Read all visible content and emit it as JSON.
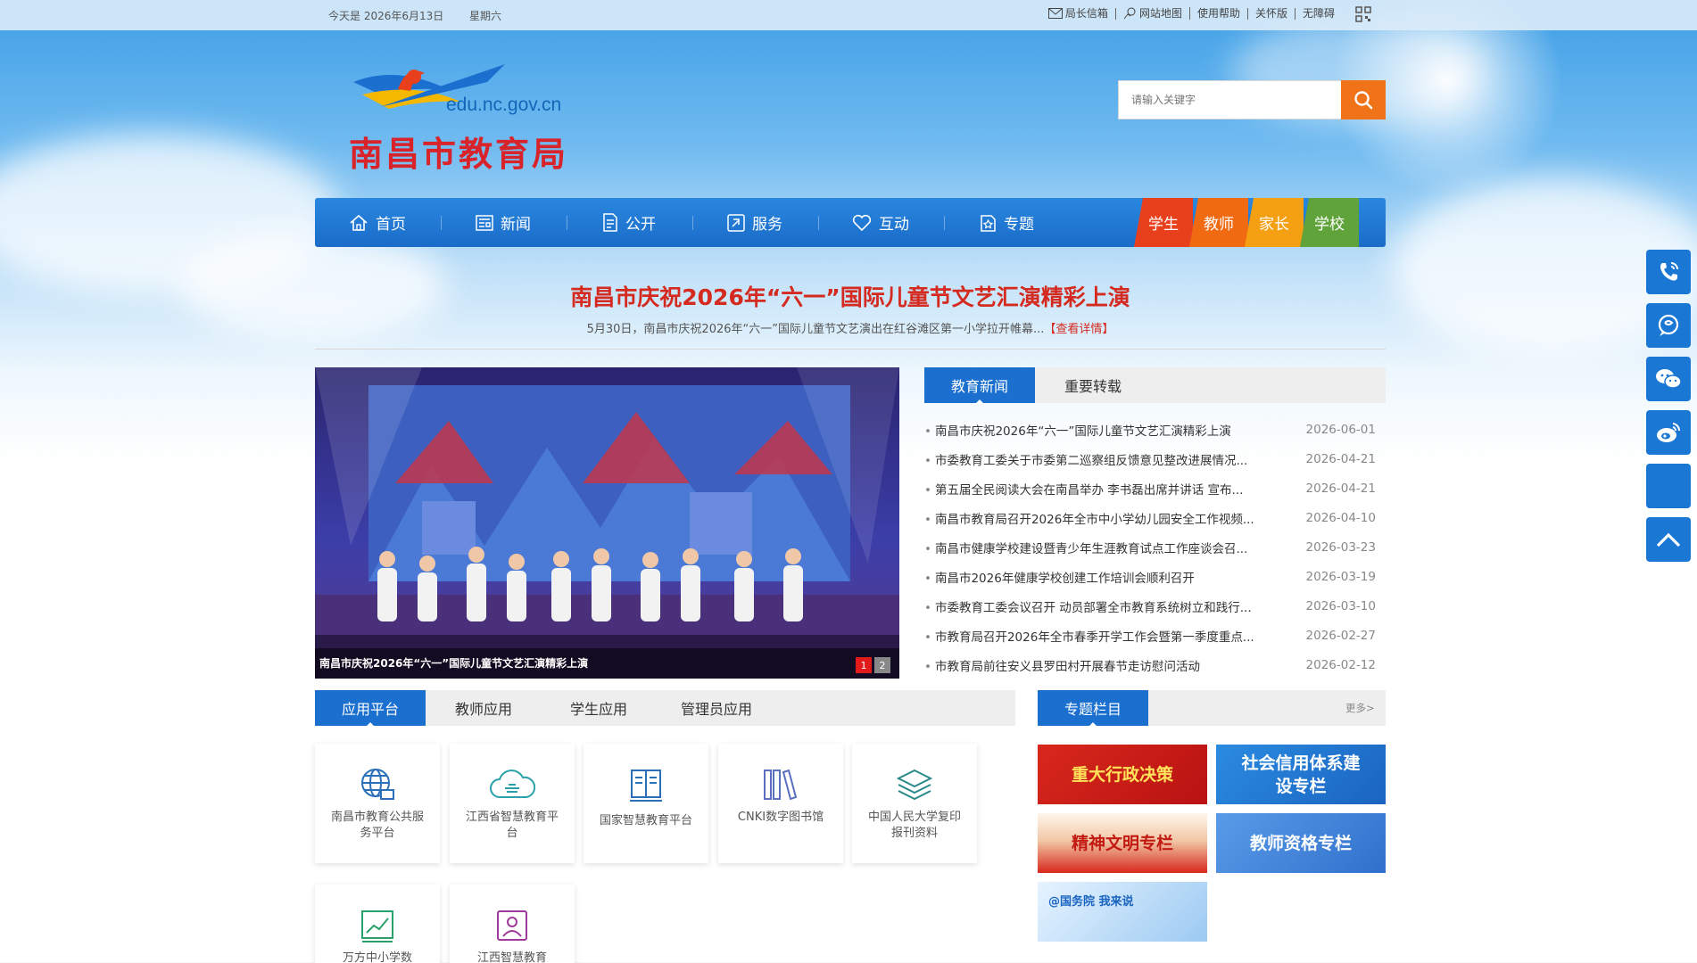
{
  "topbar": {
    "date": "今天是 2026年6月13日",
    "weekday": "星期六",
    "links": [
      "局长信箱",
      "网站地图",
      "使用帮助",
      "关怀版",
      "无障碍"
    ]
  },
  "logo": {
    "url": "edu.nc.gov.cn",
    "name": "南昌市教育局"
  },
  "search": {
    "placeholder": "请输入关键字"
  },
  "nav": {
    "items": [
      "首页",
      "新闻",
      "公开",
      "服务",
      "互动",
      "专题"
    ],
    "roles": [
      "学生",
      "教师",
      "家长",
      "学校"
    ],
    "role_colors": [
      "#e8401c",
      "#f06a12",
      "#f5a012",
      "#5fa33a"
    ]
  },
  "headline": {
    "title": "南昌市庆祝2026年“六一”国际儿童节文艺汇演精彩上演",
    "summary": "5月30日，南昌市庆祝2026年“六一”国际儿童节文艺演出在红谷滩区第一小学拉开帷幕...",
    "more": "【查看详情】"
  },
  "slideshow": {
    "caption": "南昌市庆祝2026年“六一”国际儿童节文艺汇演精彩上演",
    "pages": [
      "1",
      "2"
    ]
  },
  "news": {
    "tabs": [
      "教育新闻",
      "重要转载"
    ],
    "items": [
      {
        "title": "南昌市庆祝2026年“六一”国际儿童节文艺汇演精彩上演",
        "date": "2026-06-01"
      },
      {
        "title": "市委教育工委关于市委第二巡察组反馈意见整改进展情况...",
        "date": "2026-04-21"
      },
      {
        "title": "第五届全民阅读大会在南昌举办 李书磊出席并讲话 宣布...",
        "date": "2026-04-21"
      },
      {
        "title": "南昌市教育局召开2026年全市中小学幼儿园安全工作视频...",
        "date": "2026-04-10"
      },
      {
        "title": "南昌市健康学校建设暨青少年生涯教育试点工作座谈会召...",
        "date": "2026-03-23"
      },
      {
        "title": "南昌市2026年健康学校创建工作培训会顺利召开",
        "date": "2026-03-19"
      },
      {
        "title": "市委教育工委会议召开 动员部署全市教育系统树立和践行...",
        "date": "2026-03-10"
      },
      {
        "title": "市教育局召开2026年全市春季开学工作会暨第一季度重点...",
        "date": "2026-02-27"
      },
      {
        "title": "市教育局前往安义县罗田村开展春节走访慰问活动",
        "date": "2026-02-12"
      }
    ]
  },
  "apps": {
    "tabs": [
      "应用平台",
      "教师应用",
      "学生应用",
      "管理员应用"
    ],
    "items": [
      {
        "label": "南昌市教育公共服务平台",
        "icon": "globe-icon"
      },
      {
        "label": "江西省智慧教育平台",
        "icon": "cloud-icon"
      },
      {
        "label": "国家智慧教育平台",
        "icon": "book-icon"
      },
      {
        "label": "CNKI数字图书馆",
        "icon": "library-icon"
      },
      {
        "label": "中国人民大学复印报刊资料",
        "icon": "layers-icon"
      },
      {
        "label": "万方中小学数",
        "icon": "chart-icon"
      },
      {
        "label": "江西智慧教育",
        "icon": "profile-icon"
      }
    ]
  },
  "special": {
    "tab": "专题栏目",
    "more": "更多>",
    "banners": [
      "重大行政决策",
      "社会信用体系建设专栏",
      "精神文明专栏",
      "教师资格专栏",
      "@国务院 我来说"
    ]
  }
}
